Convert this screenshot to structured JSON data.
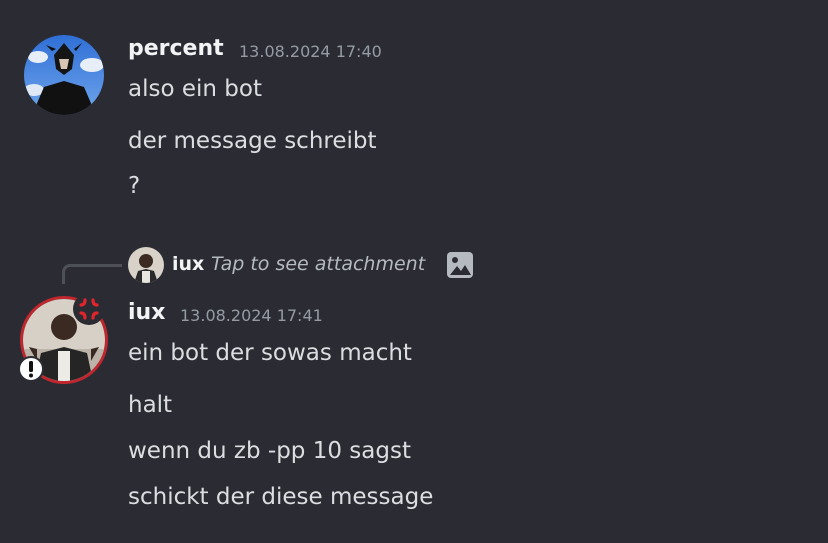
{
  "messages": [
    {
      "author": "percent",
      "timestamp": "13.08.2024 17:40",
      "lines": [
        "also ein bot",
        "der message schreibt",
        "?"
      ]
    },
    {
      "reply": {
        "author": "iux",
        "text": "Tap to see attachment",
        "attachment_icon": "image-icon"
      },
      "author": "iux",
      "timestamp": "13.08.2024 17:41",
      "lines": [
        "ein bot der sowas macht",
        "halt",
        "wenn du zb -pp 10 sagst",
        "schickt der diese message"
      ],
      "badges": [
        "anger-symbol",
        "warning-exclamation"
      ]
    }
  ],
  "colors": {
    "background": "#2b2c33",
    "author": "#f2f3f5",
    "text": "#dbdee1",
    "timestamp": "#949ba4",
    "avatar_ring": "#c0262d"
  }
}
